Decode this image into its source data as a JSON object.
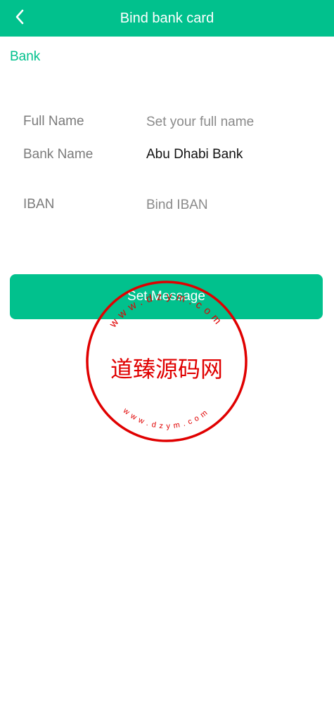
{
  "header": {
    "title": "Bind bank card",
    "back_icon": "chevron-left-icon"
  },
  "section": {
    "title": "Bank"
  },
  "form": {
    "full_name": {
      "label": "Full Name",
      "placeholder": "Set your full name",
      "value": ""
    },
    "bank_name": {
      "label": "Bank Name",
      "value": "Abu Dhabi Bank"
    },
    "iban": {
      "label": "IBAN",
      "placeholder": "Bind IBAN",
      "value": ""
    }
  },
  "submit": {
    "label": "Set Message"
  },
  "watermark": {
    "text": "道臻源码网",
    "url_top": "www.dzym.com",
    "url_bottom": "www.dzym.com"
  },
  "colors": {
    "primary": "#01c18d",
    "label": "#7b7b7b",
    "value": "#111111",
    "watermark": "#e00000"
  }
}
